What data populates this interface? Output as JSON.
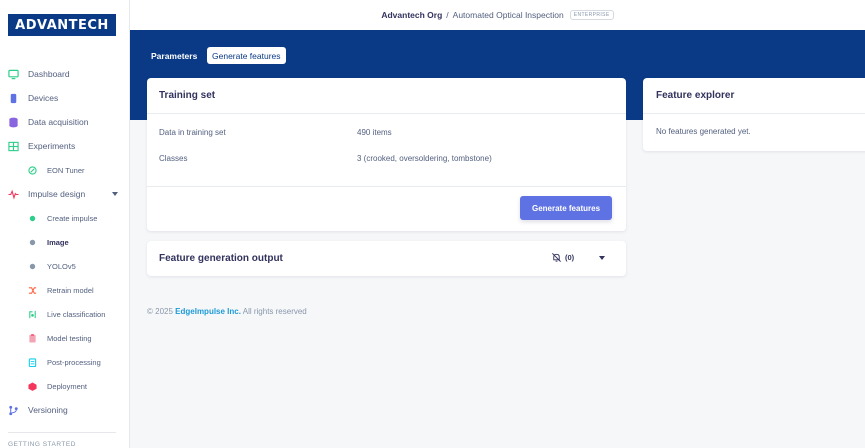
{
  "brand": {
    "logo_text": "ADVANTECH",
    "logo_color": "#0a3a86"
  },
  "topbar": {
    "org": "Advantech Org",
    "separator": "/",
    "project": "Automated Optical Inspection",
    "badge": "ENTERPRISE"
  },
  "sidebar": {
    "items": [
      {
        "label": "Dashboard",
        "icon": "monitor-icon",
        "color": "#2dce89"
      },
      {
        "label": "Devices",
        "icon": "devices-icon",
        "color": "#5e72e4"
      },
      {
        "label": "Data acquisition",
        "icon": "database-icon",
        "color": "#8965e0"
      },
      {
        "label": "Experiments",
        "icon": "grid-icon",
        "color": "#2dce89"
      },
      {
        "label": "EON Tuner",
        "icon": "tuner-icon",
        "color": "#2dce89"
      },
      {
        "label": "Impulse design",
        "icon": "pulse-icon",
        "color": "#f5365c"
      },
      {
        "label": "Create impulse",
        "icon": "dot-green-icon",
        "color": "#2dce89"
      },
      {
        "label": "Image",
        "icon": "dot-gray-icon",
        "color": "#8898aa"
      },
      {
        "label": "YOLOv5",
        "icon": "dot-gray-icon",
        "color": "#8898aa"
      },
      {
        "label": "Retrain model",
        "icon": "shuffle-icon",
        "color": "#fb6340"
      },
      {
        "label": "Live classification",
        "icon": "live-icon",
        "color": "#2dce89"
      },
      {
        "label": "Model testing",
        "icon": "clipboard-icon",
        "color": "#f3a4b5"
      },
      {
        "label": "Post-processing",
        "icon": "document-icon",
        "color": "#11cdef"
      },
      {
        "label": "Deployment",
        "icon": "cube-icon",
        "color": "#f5365c"
      },
      {
        "label": "Versioning",
        "icon": "branch-icon",
        "color": "#5e72e4"
      }
    ],
    "section_label": "GETTING STARTED"
  },
  "tabs": {
    "parameters": "Parameters",
    "generate": "Generate features"
  },
  "training_set": {
    "title": "Training set",
    "rows": [
      {
        "key": "Data in training set",
        "value": "490 items"
      },
      {
        "key": "Classes",
        "value": "3 (crooked, oversoldering, tombstone)"
      }
    ],
    "button": "Generate features"
  },
  "output": {
    "title": "Feature generation output",
    "count": "(0)"
  },
  "explorer": {
    "title": "Feature explorer",
    "empty": "No features generated yet."
  },
  "footer": {
    "prefix": "© 2025",
    "company": "EdgeImpulse Inc.",
    "suffix": "All rights reserved"
  },
  "colors": {
    "primary": "#0a3a86",
    "button": "#5e72e4",
    "link": "#1e9bd7"
  }
}
